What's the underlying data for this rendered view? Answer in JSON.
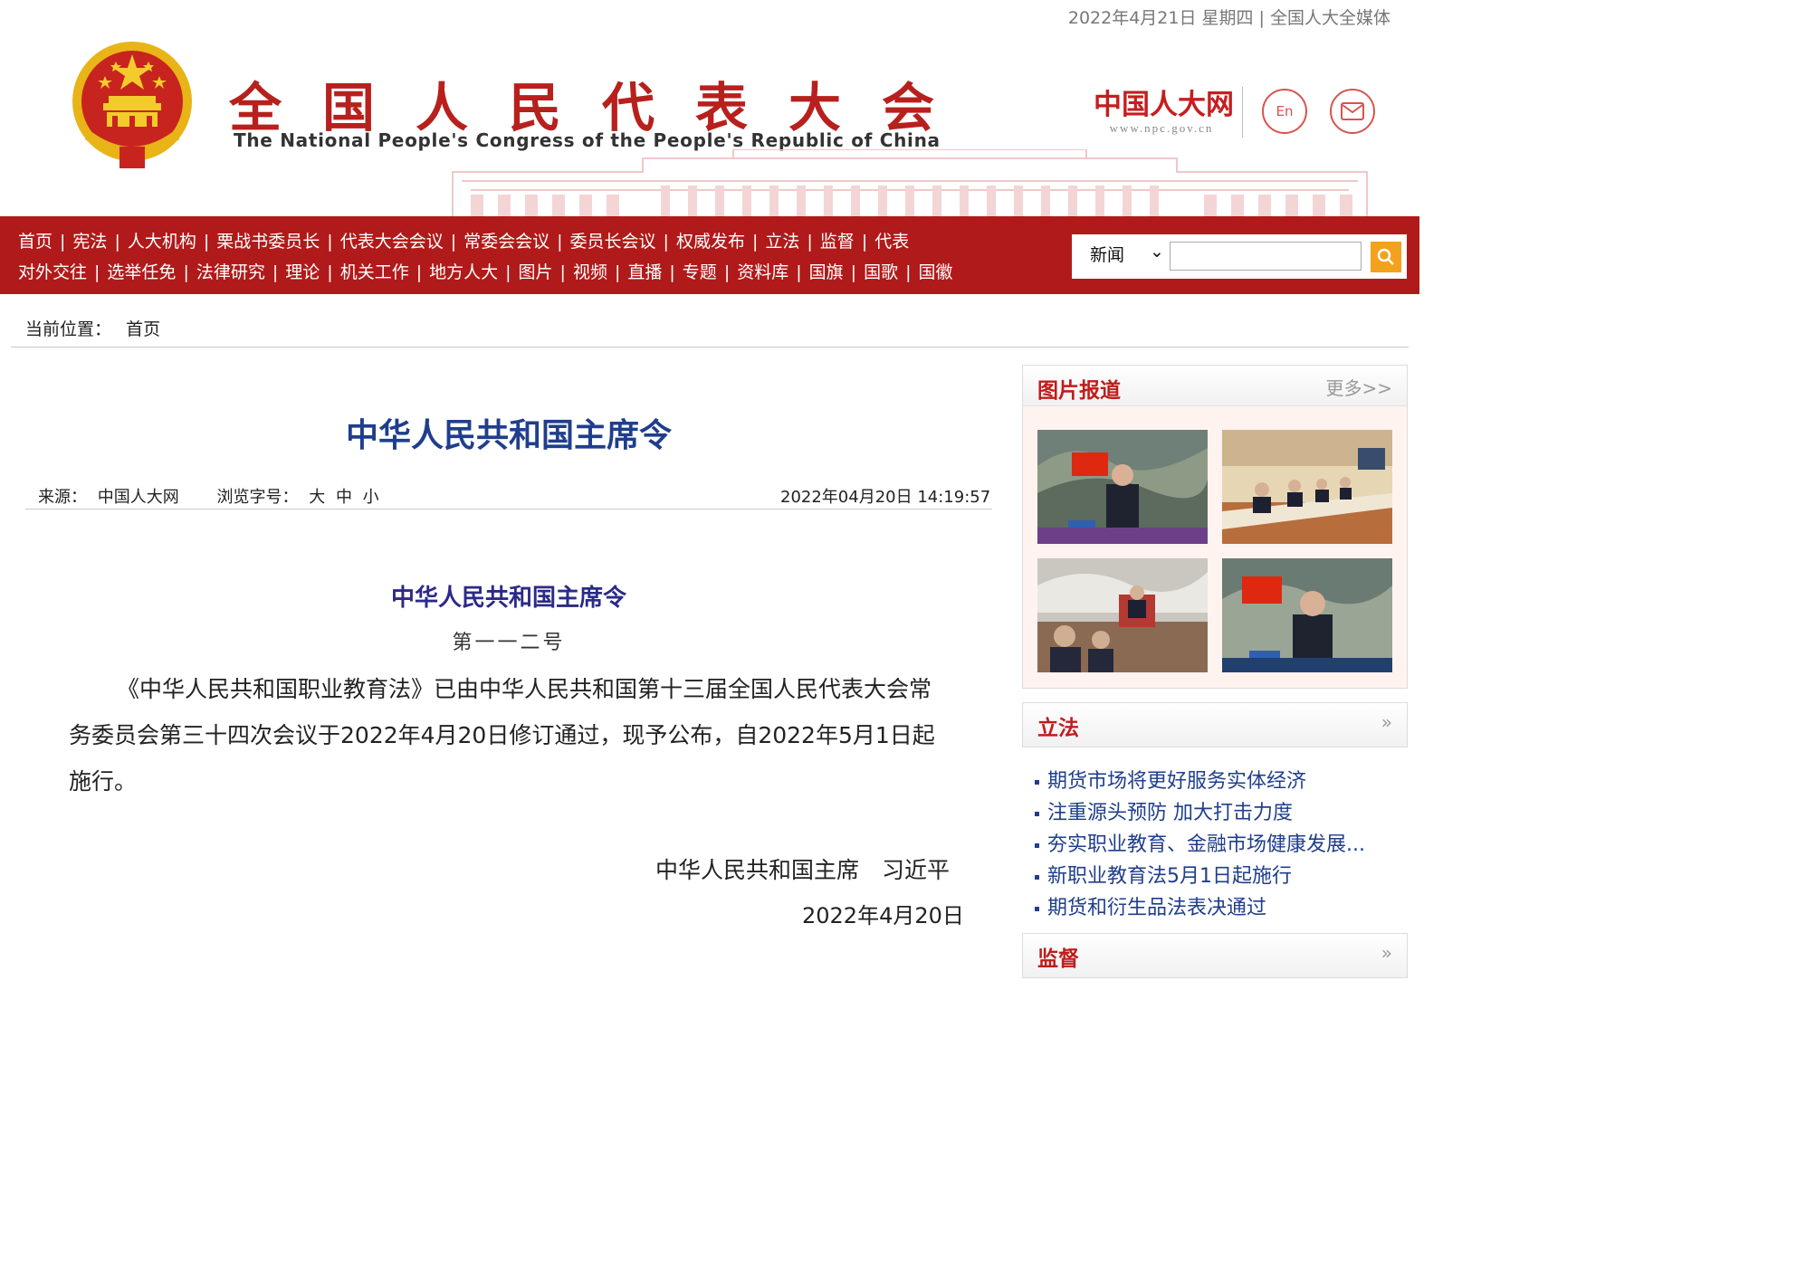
{
  "header": {
    "topline": "2022年4月21日 星期四 | 全国人大全媒体",
    "title_cn": "全国人民代表大会",
    "title_en": "The National People's Congress of the People's Republic of China",
    "site_name": "中国人大网",
    "site_url": "www.npc.gov.cn",
    "en_label": "En"
  },
  "nav": {
    "row1": [
      "首页",
      "宪法",
      "人大机构",
      "栗战书委员长",
      "代表大会会议",
      "常委会会议",
      "委员长会议",
      "权威发布",
      "立法",
      "监督",
      "代表"
    ],
    "row2": [
      "对外交往",
      "选举任免",
      "法律研究",
      "理论",
      "机关工作",
      "地方人大",
      "图片",
      "视频",
      "直播",
      "专题",
      "资料库",
      "国旗",
      "国歌",
      "国徽"
    ]
  },
  "search": {
    "category": "新闻",
    "placeholder": ""
  },
  "breadcrumb": {
    "label": "当前位置：",
    "current": "首页"
  },
  "article": {
    "title": "中华人民共和国主席令",
    "source_label": "来源：",
    "source": "中国人大网",
    "fontsize_label": "浏览字号：",
    "size_large": "大",
    "size_medium": "中",
    "size_small": "小",
    "datetime": "2022年04月20日 14:19:57",
    "order_title": "中华人民共和国主席令",
    "order_number": "第一一二号",
    "body": "《中华人民共和国职业教育法》已由中华人民共和国第十三届全国人民代表大会常务委员会第三十四次会议于2022年4月20日修订通过，现予公布，自2022年5月1日起施行。",
    "signature": "中华人民共和国主席　习近平",
    "sign_date": "2022年4月20日"
  },
  "sidebar": {
    "photos": {
      "title": "图片报道",
      "more": "更多>>"
    },
    "legislation": {
      "title": "立法",
      "more": "»",
      "items": [
        "期货市场将更好服务实体经济",
        "注重源头预防 加大打击力度",
        "夯实职业教育、金融市场健康发展...",
        "新职业教育法5月1日起施行",
        "期货和衍生品法表决通过"
      ]
    },
    "supervision": {
      "title": "监督",
      "more": "»"
    }
  },
  "colors": {
    "brand_red": "#b11a1a",
    "title_blue": "#1f3e8c",
    "search_button": "#f2a21c"
  }
}
